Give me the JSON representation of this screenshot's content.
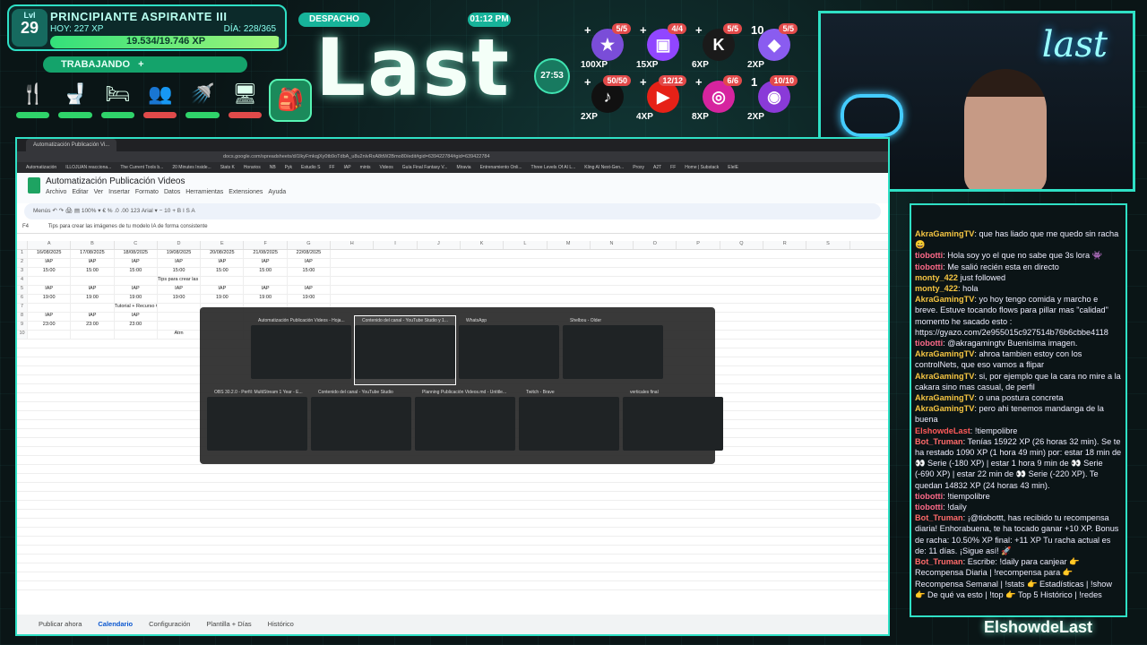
{
  "hud": {
    "level_label": "Lvl",
    "level": "29",
    "rank": "PRINCIPIANTE ASPIRANTE III",
    "today": "HOY: 227 XP",
    "day": "DÍA: 228/365",
    "xp": "19.534/19.746 XP",
    "xp_fraction": 0.989,
    "status": "TRABAJANDO",
    "status_plus": "+",
    "needs": [
      {
        "icon": "utensils-icon",
        "glyph": "🍴",
        "color": "#2fd36a"
      },
      {
        "icon": "toilet-icon",
        "glyph": "🚽",
        "color": "#2fd36a"
      },
      {
        "icon": "bed-icon",
        "glyph": "🛏",
        "color": "#2fd36a"
      },
      {
        "icon": "people-icon",
        "glyph": "👥",
        "color": "#e04a4a"
      },
      {
        "icon": "shower-icon",
        "glyph": "🚿",
        "color": "#2fd36a"
      },
      {
        "icon": "computer-icon",
        "glyph": "🖥",
        "color": "#e04a4a"
      }
    ],
    "bag_glyph": "🎒"
  },
  "badges": {
    "despacho": "DESPACHO",
    "clock": "01:12 PM",
    "brand": "Last",
    "timer": "27:53"
  },
  "goals": [
    {
      "icon": "star-icon",
      "plus": "+",
      "count": "5/5",
      "xp": "100XP",
      "glyph": "★",
      "bg": "#7a4dd8"
    },
    {
      "icon": "twitch-icon",
      "plus": "+",
      "count": "4/4",
      "xp": "15XP",
      "glyph": "▣",
      "bg": "#9146ff"
    },
    {
      "icon": "kick-icon",
      "plus": "+",
      "count": "5/5",
      "xp": "6XP",
      "glyph": "K",
      "bg": "#1a1a1a"
    },
    {
      "icon": "gem-icon",
      "plus": "10",
      "count": "5/5",
      "xp": "2XP",
      "glyph": "◆",
      "bg": "#8a5cf0"
    },
    {
      "icon": "tiktok-icon",
      "plus": "+",
      "count": "50/50",
      "xp": "2XP",
      "glyph": "♪",
      "bg": "#111"
    },
    {
      "icon": "youtube-icon",
      "plus": "+",
      "count": "12/12",
      "xp": "4XP",
      "glyph": "▶",
      "bg": "#e62117"
    },
    {
      "icon": "instagram-icon",
      "plus": "+",
      "count": "6/6",
      "xp": "8XP",
      "glyph": "◎",
      "bg": "#d6249f"
    },
    {
      "icon": "podcast-icon",
      "plus": "1",
      "count": "10/10",
      "xp": "2XP",
      "glyph": "◉",
      "bg": "#8a3ad8"
    }
  ],
  "cam": {
    "neon": "last"
  },
  "chat": [
    {
      "user": "AkraGamingTV",
      "color": "#f5c542",
      "text": ": que has liado que me quedo sin racha 😄"
    },
    {
      "user": "tiobotti",
      "color": "#ff6a8a",
      "text": ": Hola soy yo el que no sabe que 3s lora 👾"
    },
    {
      "user": "tiobotti",
      "color": "#ff6a8a",
      "text": ": Me salió recién esta en directo"
    },
    {
      "user": "monty_422",
      "color": "#f5c542",
      "text": " just followed"
    },
    {
      "user": "monty_422",
      "color": "#f5c542",
      "text": ": hola"
    },
    {
      "user": "AkraGamingTV",
      "color": "#f5c542",
      "text": ": yo hoy tengo comida y marcho e breve. Estuve tocando flows para pillar mas \"calidad\" momento he sacado esto : https://gyazo.com/2e955015c927514b76b6cbbe4118"
    },
    {
      "user": "tiobotti",
      "color": "#ff6a8a",
      "text": ": @akragamingtv Buenisima imagen."
    },
    {
      "user": "AkraGamingTV",
      "color": "#f5c542",
      "text": ": ahroa tambien estoy con los controlNets, que eso vamos a flipar"
    },
    {
      "user": "AkraGamingTV",
      "color": "#f5c542",
      "text": ": si, por ejemplo que la cara no mire a la cakara sino mas casual, de perfil"
    },
    {
      "user": "AkraGamingTV",
      "color": "#f5c542",
      "text": ": o una postura concreta"
    },
    {
      "user": "AkraGamingTV",
      "color": "#f5c542",
      "text": ": pero ahi tenemos mandanga de la buena"
    },
    {
      "user": "ElshowdeLast",
      "color": "#ff5a5a",
      "text": ": !tiempolibre"
    },
    {
      "user": "Bot_Truman",
      "color": "#ff6a6a",
      "text": ": Tenías 15922 XP (26 horas 32 min). Se te ha restado 1090 XP (1 hora 49 min) por: estar 18 min de 👀 Serie (-180 XP) | estar 1 hora 9 min de 👀 Serie (-690 XP) | estar 22 min de 👀 Serie (-220 XP). Te quedan 14832 XP (24 horas 43 min)."
    },
    {
      "user": "tiobotti",
      "color": "#ff6a8a",
      "text": ": !tiempolibre"
    },
    {
      "user": "tiobotti",
      "color": "#ff6a8a",
      "text": ": !daily"
    },
    {
      "user": "Bot_Truman",
      "color": "#ff6a6a",
      "text": ": ¡@tiobottt, has recibido tu recompensa diaria! Enhorabuena, te ha tocado ganar +10 XP. Bonus de racha: 10.50% XP final: +11 XP Tu racha actual es de: 11 días. ¡Sigue así! 🚀"
    },
    {
      "user": "Bot_Truman",
      "color": "#ff6a6a",
      "text": ": Escribe: !daily para canjear 👉 Recompensa Diaria | !recompensa para 👉 Recompensa Semanal | !stats 👉 Estadísticas | !show 👉 De qué va esto | !top 👉 Top 5 Histórico | !redes"
    }
  ],
  "footer_name": "ElshowdeLast",
  "browser": {
    "tab": "Automatización Publicación Vi...",
    "url": "docs.google.com/spreadsheets/d/1lkyFmkqjXy0tb9oTdbA_u8u2nlvRxA8ttW2Bmo80/edit#gid=639422784#gid=639422784",
    "bookmarks": [
      "Automatización",
      "ILLOJUAN reacciona...",
      "The Current Tools b...",
      "20 Minutes Inside...",
      "Stats K",
      "Horarios",
      "NB",
      "Pyk",
      "Estudio S",
      "FF",
      "IAP",
      "mints",
      "Videos",
      "Guía Final Fantasy V...",
      "Miravia",
      "Entrenamiento Onli...",
      "Three Levels Of AI L...",
      "Kling AI Next-Gen...",
      "Proxy",
      "A2T",
      "FF",
      "Home | Substack",
      "ElelE"
    ]
  },
  "sheets": {
    "title": "Automatización Publicación Videos",
    "menu": [
      "Archivo",
      "Editar",
      "Ver",
      "Insertar",
      "Formato",
      "Datos",
      "Herramientas",
      "Extensiones",
      "Ayuda"
    ],
    "toolbar": "Menús   ↶  ↷  🖨  ▤   100%  ▾   €   %   .0   .00   123   Arial  ▾   −  10  +   B   I   S   A",
    "cell_ref": "F4",
    "formula": "Tips para crear las imágenes de tu modelo IA de forma consistente",
    "columns": [
      "",
      "A",
      "B",
      "C",
      "D",
      "E",
      "F",
      "G",
      "H",
      "I",
      "J",
      "K",
      "L",
      "M",
      "N",
      "O",
      "P",
      "Q",
      "R",
      "S"
    ],
    "rows": [
      [
        "1",
        "16/08/2025",
        "17/08/2025",
        "18/08/2025",
        "19/08/2025",
        "20/08/2025",
        "21/08/2025",
        "22/08/2025"
      ],
      [
        "2",
        "IAP",
        "IAP",
        "IAP",
        "IAP",
        "IAP",
        "IAP",
        "IAP"
      ],
      [
        "3",
        "15:00",
        "15:00",
        "15:00",
        "15:00",
        "15:00",
        "15:00",
        "15:00"
      ],
      [
        "4",
        "",
        "",
        "",
        "Tips para crear las imágenes de tu modelo IA de forma consistente",
        "",
        "",
        ""
      ],
      [
        "5",
        "IAP",
        "IAP",
        "IAP",
        "IAP",
        "IAP",
        "IAP",
        "IAP"
      ],
      [
        "6",
        "19:00",
        "19:00",
        "19:00",
        "19:00",
        "19:00",
        "19:00",
        "19:00"
      ],
      [
        "7",
        "",
        "",
        "Tutorial + Recurso Gratis de Cómo crear tu model RIEN al LoRA de tu modelo IA",
        "",
        "",
        "",
        ""
      ],
      [
        "8",
        "IAP",
        "IAP",
        "IAP",
        "",
        "",
        "",
        ""
      ],
      [
        "9",
        "23:00",
        "23:00",
        "23:00",
        "",
        "",
        "",
        ""
      ],
      [
        "10",
        "",
        "",
        "",
        "Atrn",
        "",
        "",
        ""
      ]
    ],
    "tabs": [
      "Publicar ahora",
      "Calendario",
      "Configuración",
      "Plantilla + Días",
      "Histórico"
    ],
    "active_tab": "Calendario"
  },
  "switcher": [
    {
      "title": "Automatización Publicación Videos - Hoja..."
    },
    {
      "title": "Contenido del canal - YouTube Studio y 1..."
    },
    {
      "title": "WhatsApp"
    },
    {
      "title": "Shelbou - Older"
    },
    {
      "title": "OBS 30.2.0 - Perfil: MultiStream 1 Year - E..."
    },
    {
      "title": "Contenido del canal - YouTube Studio"
    },
    {
      "title": "Planning Publicación Videos.md - Untitle..."
    },
    {
      "title": "Twitch - Brave"
    },
    {
      "title": "verticales final"
    }
  ]
}
